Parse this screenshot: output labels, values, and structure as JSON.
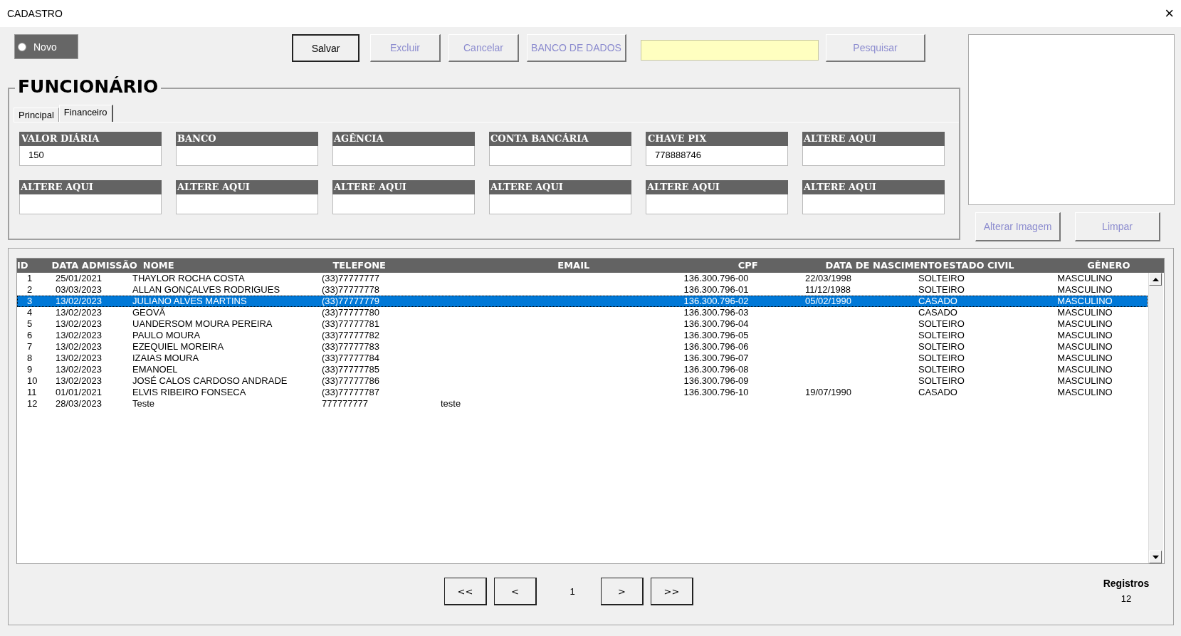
{
  "window": {
    "title": "CADASTRO",
    "close": "×"
  },
  "new_toggle": {
    "label": "Novo",
    "on": false
  },
  "toolbar": [
    {
      "label": "Salvar",
      "disabled": false
    },
    {
      "label": "Excluir",
      "disabled": true
    },
    {
      "label": "Cancelar",
      "disabled": true
    },
    {
      "label": "BANCO DE DADOS",
      "disabled": true
    }
  ],
  "search_button": {
    "label": "Pesquisar",
    "disabled": true
  },
  "image_buttons": [
    {
      "label": "Alterar Imagem",
      "disabled": true
    },
    {
      "label": "Limpar",
      "disabled": true
    }
  ],
  "section_title": "FUNCIONÁRIO",
  "tabs": [
    {
      "label": "Principal",
      "selected": false
    },
    {
      "label": "Financeiro",
      "selected": true
    }
  ],
  "fields": [
    {
      "label": "VALOR DIÁRIA",
      "value": "150"
    },
    {
      "label": "BANCO"
    },
    {
      "label": "AGÊNCIA"
    },
    {
      "label": "CONTA BANCÁRIA"
    },
    {
      "label": "CHAVE PIX",
      "value": "778888746"
    },
    {
      "label": "ALTERE AQUI"
    },
    {
      "label": "ALTERE AQUI"
    },
    {
      "label": "ALTERE AQUI"
    },
    {
      "label": "ALTERE AQUI"
    },
    {
      "label": "ALTERE AQUI"
    },
    {
      "label": "ALTERE AQUI"
    },
    {
      "label": "ALTERE AQUI"
    }
  ],
  "table": {
    "columns": [
      "ID",
      "DATA ADMISSÃO",
      "NOME",
      "TELEFONE",
      "EMAIL",
      "CPF",
      "DATA DE NASCIMENTO",
      "ESTADO CIVIL",
      "GÊNERO"
    ],
    "rows": [
      {
        "selected": false,
        "cells": [
          "1",
          "25/01/2021",
          "THAYLOR ROCHA COSTA",
          "(33)77777777",
          "",
          "136.300.796-00",
          "22/03/1998",
          "SOLTEIRO",
          "MASCULINO"
        ]
      },
      {
        "selected": false,
        "cells": [
          "2",
          "03/03/2023",
          "ALLAN GONÇALVES RODRIGUES",
          "(33)77777778",
          "",
          "136.300.796-01",
          "11/12/1988",
          "SOLTEIRO",
          "MASCULINO"
        ]
      },
      {
        "selected": true,
        "cells": [
          "3",
          "13/02/2023",
          "JULIANO ALVES MARTINS",
          "(33)77777779",
          "",
          "136.300.796-02",
          "05/02/1990",
          "CASADO",
          "MASCULINO"
        ]
      },
      {
        "selected": false,
        "cells": [
          "4",
          "13/02/2023",
          "GEOVÃ",
          "(33)77777780",
          "",
          "136.300.796-03",
          "",
          "CASADO",
          "MASCULINO"
        ]
      },
      {
        "selected": false,
        "cells": [
          "5",
          "13/02/2023",
          "UANDERSOM MOURA PEREIRA",
          "(33)77777781",
          "",
          "136.300.796-04",
          "",
          "SOLTEIRO",
          "MASCULINO"
        ]
      },
      {
        "selected": false,
        "cells": [
          "6",
          "13/02/2023",
          "PAULO MOURA",
          "(33)77777782",
          "",
          "136.300.796-05",
          "",
          "SOLTEIRO",
          "MASCULINO"
        ]
      },
      {
        "selected": false,
        "cells": [
          "7",
          "13/02/2023",
          "EZEQUIEL MOREIRA",
          "(33)77777783",
          "",
          "136.300.796-06",
          "",
          "SOLTEIRO",
          "MASCULINO"
        ]
      },
      {
        "selected": false,
        "cells": [
          "8",
          "13/02/2023",
          "IZAIAS MOURA",
          "(33)77777784",
          "",
          "136.300.796-07",
          "",
          "SOLTEIRO",
          "MASCULINO"
        ]
      },
      {
        "selected": false,
        "cells": [
          "9",
          "13/02/2023",
          "EMANOEL",
          "(33)77777785",
          "",
          "136.300.796-08",
          "",
          "SOLTEIRO",
          "MASCULINO"
        ]
      },
      {
        "selected": false,
        "cells": [
          "10",
          "13/02/2023",
          "JOSÉ CALOS CARDOSO ANDRADE",
          "(33)77777786",
          "",
          "136.300.796-09",
          "",
          "SOLTEIRO",
          "MASCULINO"
        ]
      },
      {
        "selected": false,
        "cells": [
          "11",
          "01/01/2021",
          "ELVIS RIBEIRO FONSECA",
          "(33)77777787",
          "",
          "136.300.796-10",
          "19/07/1990",
          "CASADO",
          "MASCULINO"
        ]
      },
      {
        "selected": false,
        "cells": [
          "12",
          "28/03/2023",
          "Teste",
          "777777777",
          "teste",
          "",
          "",
          "",
          ""
        ]
      }
    ]
  },
  "pagination": {
    "first": "<<",
    "prev": "<",
    "page": "1",
    "next": ">",
    "last": ">>"
  },
  "records": {
    "label": "Registros",
    "count": "12"
  }
}
